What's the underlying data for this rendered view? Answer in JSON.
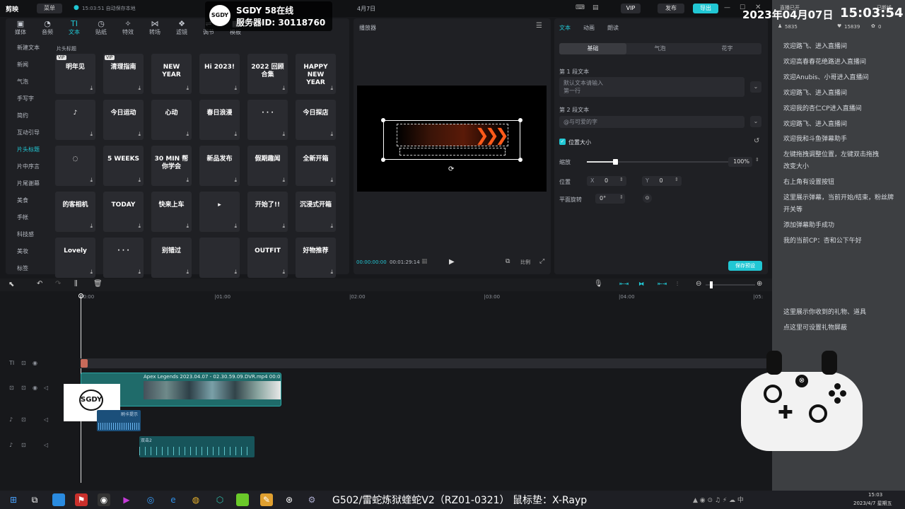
{
  "titlebar": {
    "app_name": "剪映",
    "menu_label": "菜单",
    "autosave": "15:03:51 自动保存本地",
    "project_date": "4月7日",
    "vip": "VIP",
    "publish": "发布",
    "export": "导出"
  },
  "overlay": {
    "logo_text": "SGDY",
    "channel": "SGDY 58在线",
    "server": "服务器ID: 30118760",
    "datetime_date": "2023年04月07日",
    "datetime_time": "15:03:54",
    "top_right_status": "已断线",
    "stream_label": "直播已开",
    "viewers": "5835",
    "likes": "15839",
    "gift": "0"
  },
  "tools": [
    {
      "label": "媒体",
      "icon": "▣"
    },
    {
      "label": "音频",
      "icon": "◔"
    },
    {
      "label": "文本",
      "icon": "TI"
    },
    {
      "label": "贴纸",
      "icon": "◷"
    },
    {
      "label": "特效",
      "icon": "✧"
    },
    {
      "label": "转场",
      "icon": "⋈"
    },
    {
      "label": "滤镜",
      "icon": "❖"
    },
    {
      "label": "调节",
      "icon": "⇌"
    },
    {
      "label": "模板",
      "icon": "▦"
    }
  ],
  "categories": [
    "新建文本",
    "新闻",
    "气泡",
    "手写字",
    "简约",
    "互动引导",
    "片头标题",
    "片中序言",
    "片尾谢幕",
    "美食",
    "手帐",
    "科技感",
    "美妆",
    "标签"
  ],
  "section_title": "片头标题",
  "thumbnails": [
    {
      "text": "明年见",
      "vip": true
    },
    {
      "text": "清理指南",
      "vip": true
    },
    {
      "text": "NEW YEAR"
    },
    {
      "text": "Hi 2023!"
    },
    {
      "text": "2022 回顾合集"
    },
    {
      "text": "HAPPY NEW YEAR"
    },
    {
      "text": "♪"
    },
    {
      "text": "今日运动"
    },
    {
      "text": "心动"
    },
    {
      "text": "春日浪漫"
    },
    {
      "text": "· · ·"
    },
    {
      "text": "今日探店"
    },
    {
      "text": "◌"
    },
    {
      "text": "5 WEEKS"
    },
    {
      "text": "30 MIN 帮你学会"
    },
    {
      "text": "新品发布"
    },
    {
      "text": "假期趣闻"
    },
    {
      "text": "全新开箱"
    },
    {
      "text": "的客相机"
    },
    {
      "text": "TODAY"
    },
    {
      "text": "快来上车"
    },
    {
      "text": "▸"
    },
    {
      "text": "开始了!!"
    },
    {
      "text": "沉浸式开箱"
    },
    {
      "text": "Lovely"
    },
    {
      "text": "· · ·"
    },
    {
      "text": "别错过"
    },
    {
      "text": ""
    },
    {
      "text": "OUTFIT"
    },
    {
      "text": "好物推荐"
    }
  ],
  "player": {
    "title": "播放器",
    "current_time": "00:00:00:00",
    "total_time": "00:01:29:14",
    "ratio": "比例"
  },
  "inspector": {
    "tabs": [
      "文本",
      "动画",
      "朗读"
    ],
    "subtabs": [
      "基础",
      "气泡",
      "花字"
    ],
    "para1_label": "第 1 段文本",
    "para1_text": "默认文本请输入",
    "para1_text2": "第一行",
    "para2_label": "第 2 段文本",
    "para2_text": "@与可爱的字",
    "size_label": "位置大小",
    "scale_label": "缩放",
    "scale_value": "100%",
    "pos_label": "位置",
    "pos_x_label": "X",
    "pos_x": "0",
    "pos_y_label": "Y",
    "pos_y": "0",
    "rotate_label": "平面旋转",
    "rotate_value": "0°",
    "save_preset": "保存预设"
  },
  "timeline": {
    "ticks": [
      "00:00",
      "|01:00",
      "|02:00",
      "|03:00",
      "|04:00",
      "|05:"
    ],
    "clip_label": "Apex Legends 2023.04.07 - 02.30.59.09.DVR.mp4 00:01:08",
    "audio1": "刷卡提示",
    "audio2": "双击2"
  },
  "chat": [
    "欢迎路飞、进入直播间",
    "欢迎高春春花绝路进入直播间",
    "欢迎Anubis、小哥进入直播间",
    "欢迎路飞、进入直播间",
    "欢迎我的杏仁CP进入直播间",
    "欢迎路飞、进入直播间",
    "欢迎我和斗鱼弹幕助手",
    "左键拖拽调整位置，左键双击拖拽",
    "改变大小",
    "右上角有设置按钮",
    "这里展示弹幕，当前开始/结束，粉丝牌",
    "开关等",
    "添加弹幕助手成功",
    "我的当前CP：杏和公下午好",
    "这里展示你收到的礼物、道具",
    "点这里可设置礼物屏蔽"
  ],
  "taskbar": {
    "now_playing": "G502/雷蛇炼狱蝰蛇V2（RZ01-0321） 鼠标垫：X-Rayp",
    "time": "15:03",
    "date": "2023/4/7 星期五"
  },
  "colors": {
    "accent": "#21c7d4",
    "panel": "#1f2024",
    "background": "#17181b"
  }
}
